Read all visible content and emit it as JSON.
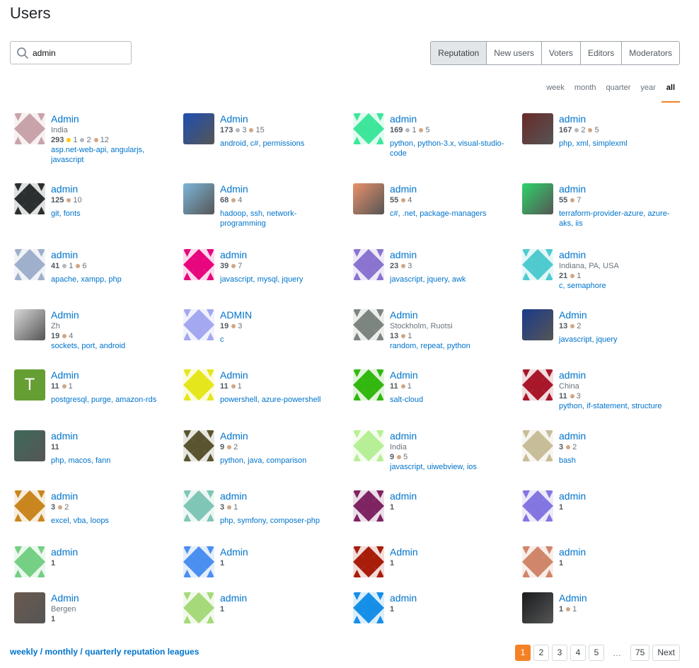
{
  "page": {
    "title": "Users"
  },
  "search": {
    "value": "admin",
    "icon": "search-icon"
  },
  "tabs": [
    {
      "label": "Reputation",
      "active": true
    },
    {
      "label": "New users",
      "active": false
    },
    {
      "label": "Voters",
      "active": false
    },
    {
      "label": "Editors",
      "active": false
    },
    {
      "label": "Moderators",
      "active": false
    }
  ],
  "periods": [
    {
      "label": "week",
      "active": false
    },
    {
      "label": "month",
      "active": false
    },
    {
      "label": "quarter",
      "active": false
    },
    {
      "label": "year",
      "active": false
    },
    {
      "label": "all",
      "active": true
    }
  ],
  "badge_colors": {
    "gold": "#ffcc01",
    "silver": "#b4b8bc",
    "bronze": "#d1a684"
  },
  "accent": {
    "link": "#0074cc",
    "orange": "#f48225"
  },
  "users": [
    {
      "name": "Admin",
      "location": "India",
      "reputation": "293",
      "gold": "1",
      "silver": "2",
      "bronze": "12",
      "tags": "asp.net-web-api, angularjs, javascript",
      "avatar_color": "#c9a3aa",
      "avatar_type": "identicon"
    },
    {
      "name": "Admin",
      "location": "",
      "reputation": "173",
      "gold": "",
      "silver": "3",
      "bronze": "15",
      "tags": "android, c#, permissions",
      "avatar_color": "#1f4fb0",
      "avatar_type": "photo"
    },
    {
      "name": "admin",
      "location": "",
      "reputation": "169",
      "gold": "",
      "silver": "1",
      "bronze": "5",
      "tags": "python, python-3.x, visual-studio-code",
      "avatar_color": "#3ee69b",
      "avatar_type": "identicon"
    },
    {
      "name": "admin",
      "location": "",
      "reputation": "167",
      "gold": "",
      "silver": "2",
      "bronze": "5",
      "tags": "php, xml, simplexml",
      "avatar_color": "#6a2a2a",
      "avatar_type": "photo"
    },
    {
      "name": "admin",
      "location": "",
      "reputation": "125",
      "gold": "",
      "silver": "",
      "bronze": "10",
      "tags": "git, fonts",
      "avatar_color": "#2b2f2f",
      "avatar_type": "identicon"
    },
    {
      "name": "Admin",
      "location": "",
      "reputation": "68",
      "gold": "",
      "silver": "",
      "bronze": "4",
      "tags": "hadoop, ssh, network-programming",
      "avatar_color": "#7db6d8",
      "avatar_type": "photo"
    },
    {
      "name": "admin",
      "location": "",
      "reputation": "55",
      "gold": "",
      "silver": "",
      "bronze": "4",
      "tags": "c#, .net, package-managers",
      "avatar_color": "#e9916b",
      "avatar_type": "photo"
    },
    {
      "name": "admin",
      "location": "",
      "reputation": "55",
      "gold": "",
      "silver": "",
      "bronze": "7",
      "tags": "terraform-provider-azure, azure-aks, iis",
      "avatar_color": "#2fd36b",
      "avatar_type": "photo"
    },
    {
      "name": "admin",
      "location": "",
      "reputation": "41",
      "gold": "",
      "silver": "1",
      "bronze": "6",
      "tags": "apache, xampp, php",
      "avatar_color": "#9fb0cc",
      "avatar_type": "identicon"
    },
    {
      "name": "admin",
      "location": "",
      "reputation": "39",
      "gold": "",
      "silver": "",
      "bronze": "7",
      "tags": "javascript, mysql, jquery",
      "avatar_color": "#e8067f",
      "avatar_type": "identicon"
    },
    {
      "name": "admin",
      "location": "",
      "reputation": "23",
      "gold": "",
      "silver": "",
      "bronze": "3",
      "tags": "javascript, jquery, awk",
      "avatar_color": "#8a74d0",
      "avatar_type": "identicon"
    },
    {
      "name": "admin",
      "location": "Indiana, PA, USA",
      "reputation": "21",
      "gold": "",
      "silver": "",
      "bronze": "1",
      "tags": "c, semaphore",
      "avatar_color": "#4fcbd0",
      "avatar_type": "identicon"
    },
    {
      "name": "Admin",
      "location": "Zh",
      "reputation": "19",
      "gold": "",
      "silver": "",
      "bronze": "4",
      "tags": "sockets, port, android",
      "avatar_color": "#d8d8d8",
      "avatar_type": "photo"
    },
    {
      "name": "ADMIN",
      "location": "",
      "reputation": "19",
      "gold": "",
      "silver": "",
      "bronze": "3",
      "tags": "c",
      "avatar_color": "#a3a8f0",
      "avatar_type": "identicon"
    },
    {
      "name": "Admin",
      "location": "Stockholm, Ruotsi",
      "reputation": "13",
      "gold": "",
      "silver": "",
      "bronze": "1",
      "tags": "random, repeat, python",
      "avatar_color": "#7d8580",
      "avatar_type": "identicon"
    },
    {
      "name": "Admin",
      "location": "",
      "reputation": "13",
      "gold": "",
      "silver": "",
      "bronze": "2",
      "tags": "javascript, jquery",
      "avatar_color": "#1a3a8a",
      "avatar_type": "photo"
    },
    {
      "name": "Admin",
      "location": "",
      "reputation": "11",
      "gold": "",
      "silver": "",
      "bronze": "1",
      "tags": "postgresql, purge, amazon-rds",
      "avatar_color": "#659e33",
      "avatar_type": "letter",
      "avatar_letter": "T"
    },
    {
      "name": "Admin",
      "location": "",
      "reputation": "11",
      "gold": "",
      "silver": "",
      "bronze": "1",
      "tags": "powershell, azure-powershell",
      "avatar_color": "#e6e61c",
      "avatar_type": "identicon"
    },
    {
      "name": "Admin",
      "location": "",
      "reputation": "11",
      "gold": "",
      "silver": "",
      "bronze": "1",
      "tags": "salt-cloud",
      "avatar_color": "#33b80f",
      "avatar_type": "identicon"
    },
    {
      "name": "admin",
      "location": "China",
      "reputation": "11",
      "gold": "",
      "silver": "",
      "bronze": "3",
      "tags": "python, if-statement, structure",
      "avatar_color": "#a8182a",
      "avatar_type": "identicon"
    },
    {
      "name": "admin",
      "location": "",
      "reputation": "11",
      "gold": "",
      "silver": "",
      "bronze": "",
      "tags": "php, macos, fann",
      "avatar_color": "#3f6a5a",
      "avatar_type": "photo"
    },
    {
      "name": "Admin",
      "location": "",
      "reputation": "9",
      "gold": "",
      "silver": "",
      "bronze": "2",
      "tags": "python, java, comparison",
      "avatar_color": "#5a5530",
      "avatar_type": "identicon"
    },
    {
      "name": "admin",
      "location": "India",
      "reputation": "9",
      "gold": "",
      "silver": "",
      "bronze": "5",
      "tags": "javascript, uiwebview, ios",
      "avatar_color": "#b7ef96",
      "avatar_type": "identicon"
    },
    {
      "name": "admin",
      "location": "",
      "reputation": "3",
      "gold": "",
      "silver": "",
      "bronze": "2",
      "tags": "bash",
      "avatar_color": "#c7bd98",
      "avatar_type": "identicon"
    },
    {
      "name": "admin",
      "location": "",
      "reputation": "3",
      "gold": "",
      "silver": "",
      "bronze": "2",
      "tags": "excel, vba, loops",
      "avatar_color": "#c9861e",
      "avatar_type": "identicon"
    },
    {
      "name": "admin",
      "location": "",
      "reputation": "3",
      "gold": "",
      "silver": "",
      "bronze": "1",
      "tags": "php, symfony, composer-php",
      "avatar_color": "#80c6b6",
      "avatar_type": "identicon"
    },
    {
      "name": "admin",
      "location": "",
      "reputation": "1",
      "gold": "",
      "silver": "",
      "bronze": "",
      "tags": "",
      "avatar_color": "#7f2463",
      "avatar_type": "identicon"
    },
    {
      "name": "admin",
      "location": "",
      "reputation": "1",
      "gold": "",
      "silver": "",
      "bronze": "",
      "tags": "",
      "avatar_color": "#8476e0",
      "avatar_type": "identicon"
    },
    {
      "name": "admin",
      "location": "",
      "reputation": "1",
      "gold": "",
      "silver": "",
      "bronze": "",
      "tags": "",
      "avatar_color": "#75cf84",
      "avatar_type": "identicon"
    },
    {
      "name": "Admin",
      "location": "",
      "reputation": "1",
      "gold": "",
      "silver": "",
      "bronze": "",
      "tags": "",
      "avatar_color": "#4b8ff0",
      "avatar_type": "identicon"
    },
    {
      "name": "Admin",
      "location": "",
      "reputation": "1",
      "gold": "",
      "silver": "",
      "bronze": "",
      "tags": "",
      "avatar_color": "#a81e0a",
      "avatar_type": "identicon"
    },
    {
      "name": "admin",
      "location": "",
      "reputation": "1",
      "gold": "",
      "silver": "",
      "bronze": "",
      "tags": "",
      "avatar_color": "#d0866a",
      "avatar_type": "identicon"
    },
    {
      "name": "Admin",
      "location": "Bergen",
      "reputation": "1",
      "gold": "",
      "silver": "",
      "bronze": "",
      "tags": "",
      "avatar_color": "#6b5a50",
      "avatar_type": "photo"
    },
    {
      "name": "admin",
      "location": "",
      "reputation": "1",
      "gold": "",
      "silver": "",
      "bronze": "",
      "tags": "",
      "avatar_color": "#a5d97a",
      "avatar_type": "identicon"
    },
    {
      "name": "admin",
      "location": "",
      "reputation": "1",
      "gold": "",
      "silver": "",
      "bronze": "",
      "tags": "",
      "avatar_color": "#168fe8",
      "avatar_type": "identicon"
    },
    {
      "name": "Admin",
      "location": "",
      "reputation": "1",
      "gold": "",
      "silver": "",
      "bronze": "1",
      "tags": "",
      "avatar_color": "#1a1c1e",
      "avatar_type": "photo"
    }
  ],
  "footer": {
    "leagues_link": "weekly / monthly / quarterly reputation leagues",
    "pagination": {
      "pages": [
        "1",
        "2",
        "3",
        "4",
        "5"
      ],
      "current": "1",
      "ellipsis": "…",
      "last": "75",
      "next": "Next"
    }
  }
}
